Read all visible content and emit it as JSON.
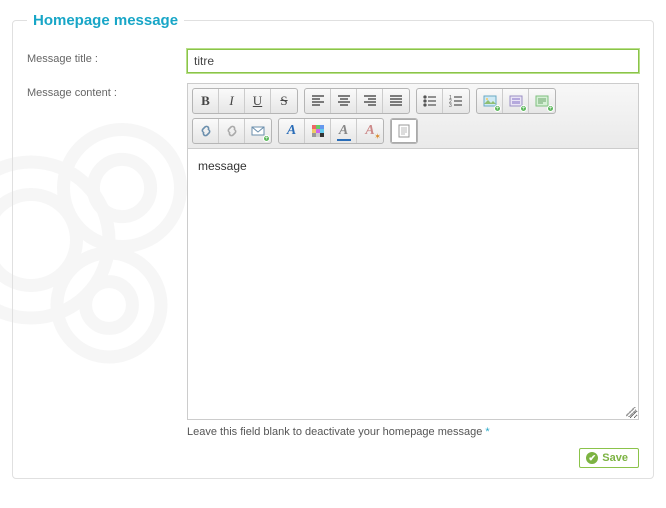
{
  "legend": "Homepage message",
  "labels": {
    "title": "Message title :",
    "content": "Message content :"
  },
  "form": {
    "title_value": "titre",
    "content_value": "message"
  },
  "hint": "Leave this field blank to deactivate your homepage message",
  "buttons": {
    "save": "Save"
  }
}
